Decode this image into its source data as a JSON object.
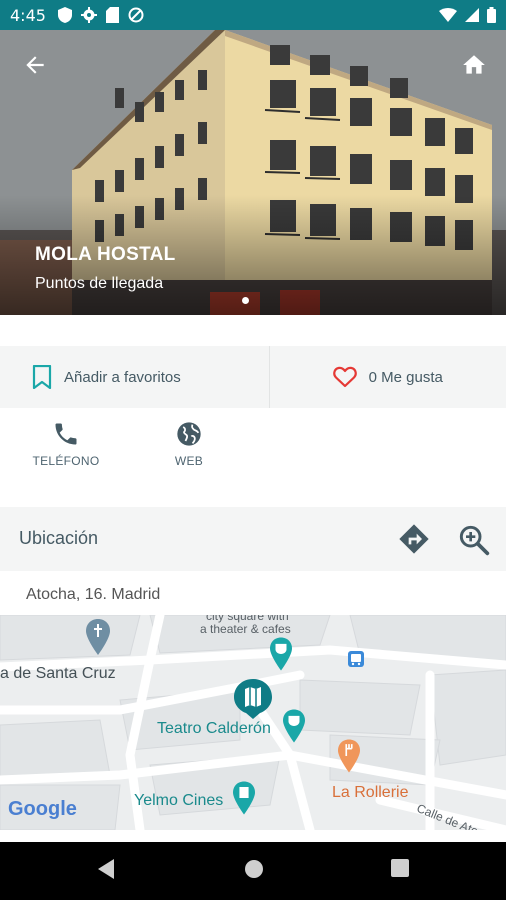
{
  "status_bar": {
    "time": "4:45"
  },
  "hero": {
    "title": "MOLA HOSTAL",
    "subtitle": "Puntos de llegada"
  },
  "actions": {
    "favorites_label": "Añadir a favoritos",
    "likes_label": "0 Me gusta"
  },
  "contact": {
    "phone_label": "TELÉFONO",
    "web_label": "WEB"
  },
  "location": {
    "header": "Ubicación",
    "address": "Atocha, 16. Madrid"
  },
  "map": {
    "labels": {
      "top_text_1": "city square with",
      "top_text_2": "a theater & cafes",
      "plaza": "a de Santa Cruz",
      "teatro": "Teatro Calderón",
      "yelmo": "Yelmo Cines",
      "rollerie": "La Rollerie",
      "street": "Calle de Atocha",
      "google": "Google"
    }
  },
  "colors": {
    "status_bar": "#0f7c86",
    "accent_teal": "#1aa7a8",
    "heart_red": "#e53935",
    "text_gray": "#455a64"
  }
}
